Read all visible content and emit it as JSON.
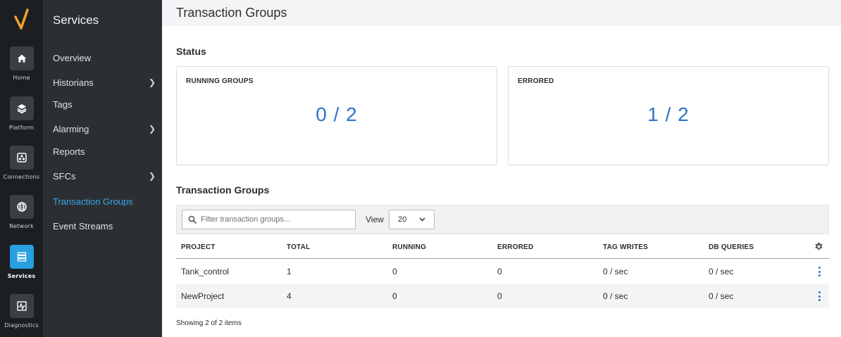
{
  "rail": {
    "items": [
      {
        "label": "Home",
        "icon": "home-icon"
      },
      {
        "label": "Platform",
        "icon": "layers-icon"
      },
      {
        "label": "Connections",
        "icon": "connections-icon"
      },
      {
        "label": "Network",
        "icon": "globe-icon"
      },
      {
        "label": "Services",
        "icon": "services-icon",
        "active": true
      },
      {
        "label": "Diagnostics",
        "icon": "pulse-icon"
      }
    ]
  },
  "subnav": {
    "title": "Services",
    "items": [
      {
        "label": "Overview"
      },
      {
        "label": "Historians",
        "has_children": true
      },
      {
        "label": "Tags"
      },
      {
        "label": "Alarming",
        "has_children": true
      },
      {
        "label": "Reports"
      },
      {
        "label": "SFCs",
        "has_children": true
      },
      {
        "label": "Transaction Groups",
        "active": true
      },
      {
        "label": "Event Streams"
      }
    ]
  },
  "header": {
    "title": "Transaction Groups"
  },
  "status": {
    "title": "Status",
    "cards": [
      {
        "label": "RUNNING GROUPS",
        "value": "0 / 2"
      },
      {
        "label": "ERRORED",
        "value": "1 / 2"
      }
    ]
  },
  "groups": {
    "title": "Transaction Groups",
    "search_placeholder": "Filter transaction groups...",
    "view_label": "View",
    "page_size": "20",
    "columns": [
      "PROJECT",
      "TOTAL",
      "RUNNING",
      "ERRORED",
      "TAG WRITES",
      "DB QUERIES"
    ],
    "rows": [
      [
        "Tank_control",
        "1",
        "0",
        "0",
        "0 / sec",
        "0 / sec"
      ],
      [
        "NewProject",
        "4",
        "0",
        "0",
        "0 / sec",
        "0 / sec"
      ]
    ],
    "footer": "Showing 2 of 2 items"
  },
  "colors": {
    "accent": "#2a9fe0",
    "value_blue": "#2d73c8",
    "logo_orange": "#f0a030"
  }
}
